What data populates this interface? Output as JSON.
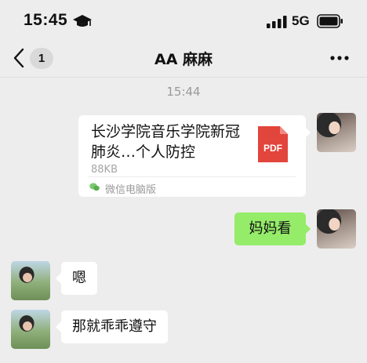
{
  "status_bar": {
    "time": "15:45",
    "network": "5G",
    "icons": [
      "graduation-cap-icon",
      "signal-bars-icon",
      "battery-icon"
    ]
  },
  "nav": {
    "back_icon": "chevron-left-icon",
    "unread_count": "1",
    "title": "AA 麻麻",
    "more_icon": "more-dots-icon"
  },
  "chat": {
    "timestamp": "15:44",
    "file_message": {
      "name": "长沙学院音乐学院新冠肺炎…个人防控",
      "size": "88KB",
      "type_label": "PDF",
      "source": "微信电脑版"
    },
    "messages": [
      {
        "sender": "self",
        "text": "妈妈看"
      },
      {
        "sender": "other",
        "text": "嗯"
      },
      {
        "sender": "other",
        "text": "那就乖乖遵守"
      }
    ]
  },
  "colors": {
    "background": "#ededed",
    "outgoing_bubble": "#95ec69",
    "incoming_bubble": "#ffffff",
    "pdf_red": "#e2453c"
  }
}
